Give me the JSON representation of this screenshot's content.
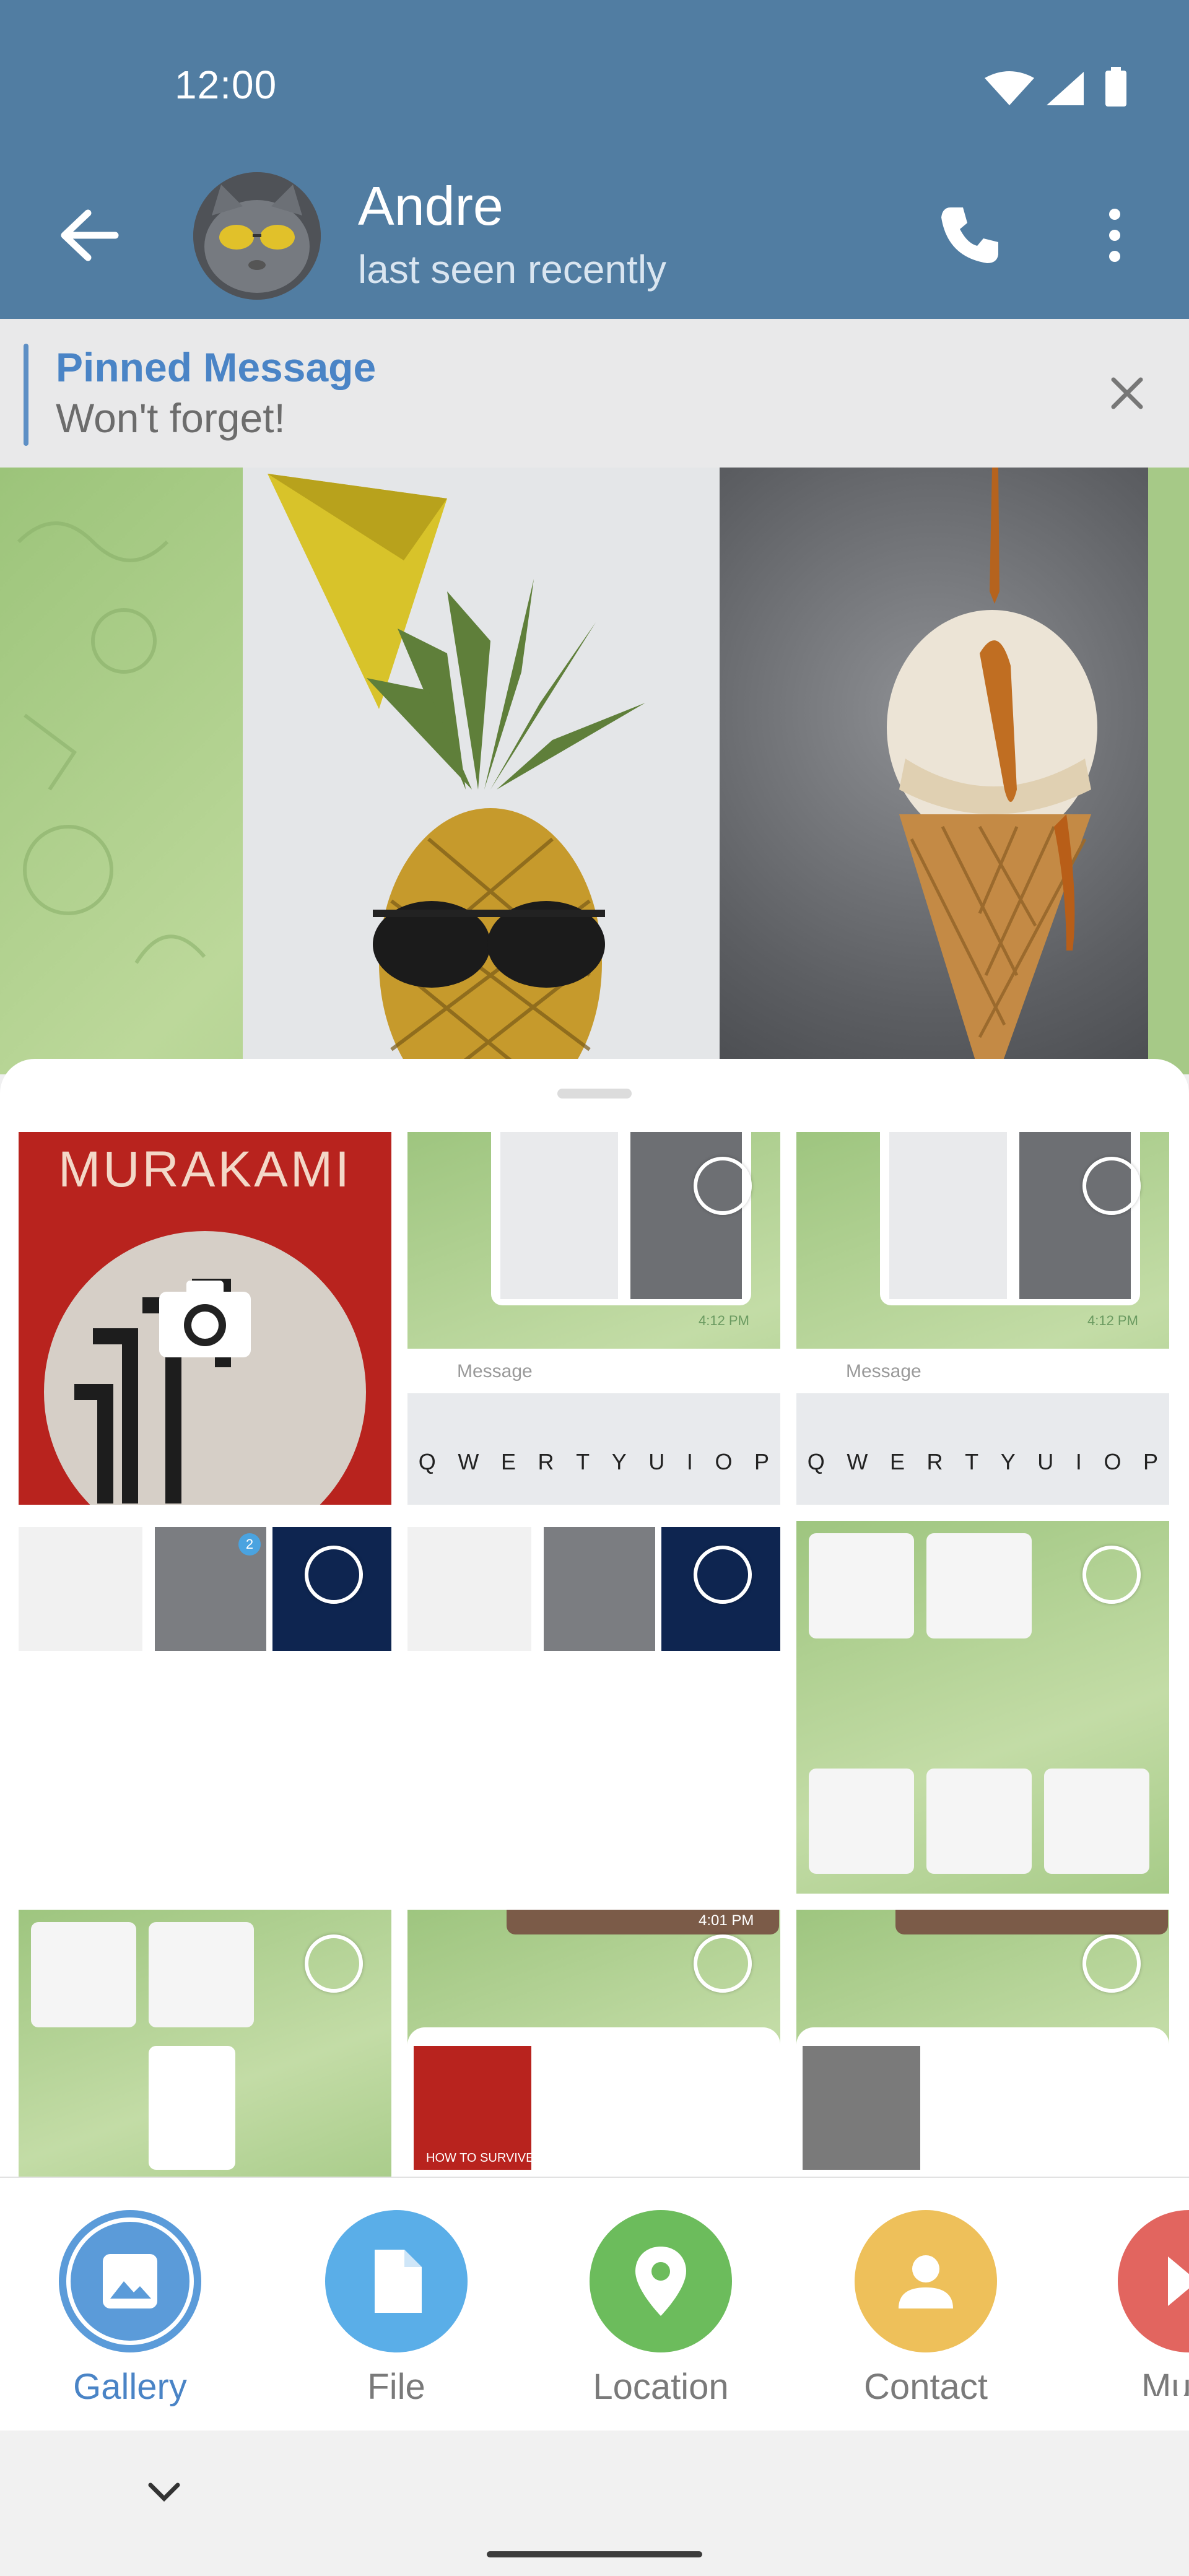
{
  "status_bar": {
    "time": "12:00"
  },
  "header": {
    "name": "Andre",
    "subtitle": "last seen recently"
  },
  "pinned": {
    "title": "Pinned Message",
    "text": "Won't forget!"
  },
  "gallery": {
    "camera_tile_text": "MURAKAMI",
    "mini_message_placeholder": "Message",
    "mini_timestamp": "4:12 PM",
    "mini_timestamp_2": "4:01 PM",
    "keyboard_keys": [
      "Q",
      "W",
      "E",
      "R",
      "T",
      "Y",
      "U",
      "I",
      "O",
      "P"
    ],
    "badge_count": "2",
    "book_text": "HOW TO SURVIVE"
  },
  "attach_menu": {
    "items": [
      {
        "label": "Gallery",
        "color": "#5b9bd9",
        "icon": "gallery-icon",
        "selected": true
      },
      {
        "label": "File",
        "color": "#5aaee8",
        "icon": "file-icon"
      },
      {
        "label": "Location",
        "color": "#6cbc5c",
        "icon": "location-icon"
      },
      {
        "label": "Contact",
        "color": "#eec05a",
        "icon": "contact-icon"
      },
      {
        "label": "Mu",
        "color": "#e2655f",
        "icon": "music-icon"
      }
    ]
  },
  "colors": {
    "header": "#517da2",
    "accent": "#4a84c6"
  }
}
